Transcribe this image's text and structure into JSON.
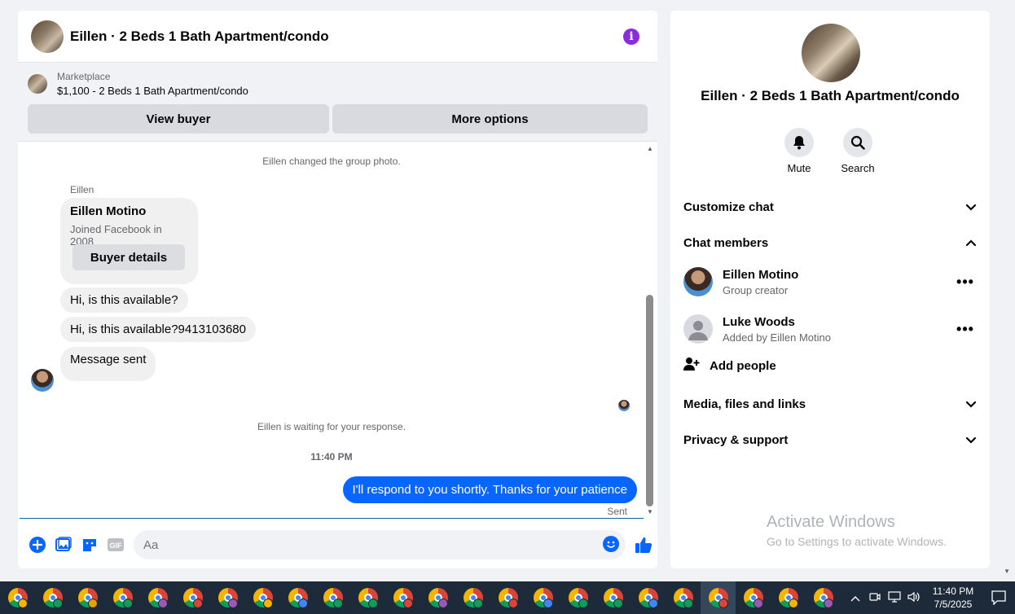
{
  "chat": {
    "title": "Eillen · 2 Beds 1 Bath Apartment/condo",
    "marketplace_label": "Marketplace",
    "listing": "$1,100 - 2 Beds 1 Bath Apartment/condo",
    "view_buyer": "View buyer",
    "more_options": "More options"
  },
  "messages": {
    "system_photo": "Eillen changed the group photo.",
    "sender": "Eillen",
    "card_name": "Eillen Motino",
    "card_sub": "Joined Facebook in 2008",
    "buyer_details": "Buyer details",
    "msg1": "Hi, is this available?",
    "msg2": "Hi, is this available?9413103680",
    "msg3": "Message sent",
    "waiting": "Eillen is waiting for your response.",
    "time": "11:40 PM",
    "outgoing": "I'll respond to you shortly. Thanks for your patience",
    "sent": "Sent"
  },
  "composer": {
    "placeholder": "Aa",
    "gif": "GIF"
  },
  "info": {
    "title": "Eillen · 2 Beds 1 Bath Apartment/condo",
    "mute": "Mute",
    "search": "Search",
    "customize": "Customize chat",
    "members_header": "Chat members",
    "members": [
      {
        "name": "Eillen Motino",
        "sub": "Group creator"
      },
      {
        "name": "Luke Woods",
        "sub": "Added by Eillen Motino"
      }
    ],
    "add_people": "Add people",
    "media": "Media, files and links",
    "privacy": "Privacy & support"
  },
  "watermark": {
    "line1": "Activate Windows",
    "line2": "Go to Settings to activate Windows."
  },
  "taskbar": {
    "time": "11:40 PM",
    "date": "7/5/2025",
    "badge_colors": [
      "#f4b400",
      "#0f9d58",
      "#e8a000",
      "#0f9d58",
      "#9b59b6",
      "#db4437",
      "#9b59b6",
      "#f4b400",
      "#4285f4",
      "#0f9d58",
      "#0f9d58",
      "#db4437",
      "#9b59b6",
      "#0f9d58",
      "#db4437",
      "#4285f4",
      "#0f9d58",
      "#0f9d58",
      "#4285f4",
      "#0f9d58",
      "#db4437",
      "#9b59b6",
      "#f4b400",
      "#9b59b6"
    ]
  },
  "colors": {
    "accent": "#0866ff",
    "info_purple": "#8a2be2"
  }
}
